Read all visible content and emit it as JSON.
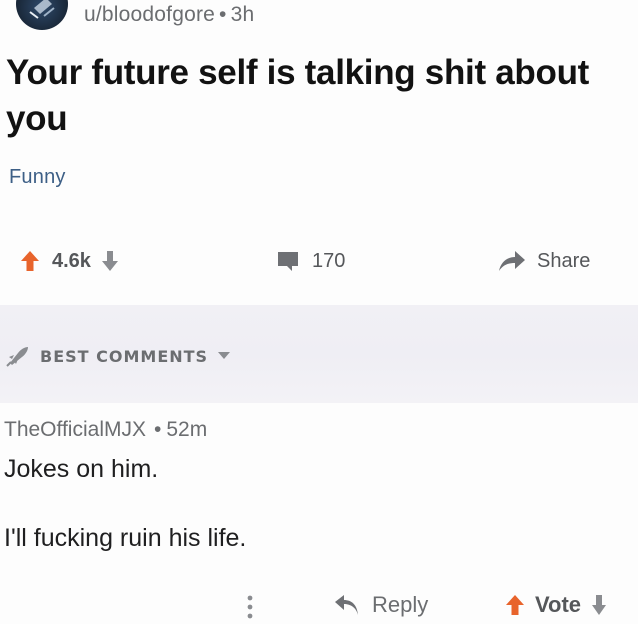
{
  "post": {
    "username": "u/bloodofgore",
    "separator": "•",
    "time": "3h",
    "title": "Your future self is talking shit about you",
    "flair": "Funny"
  },
  "actions": {
    "score": "4.6k",
    "comment_count": "170",
    "share_label": "Share"
  },
  "comments_sort": {
    "label": "BEST COMMENTS"
  },
  "comment": {
    "author": "TheOfficialMJX",
    "separator": "•",
    "time": "52m",
    "lines": [
      "Jokes on him.",
      "I'll fucking ruin his life."
    ],
    "reply_label": "Reply",
    "vote_label": "Vote"
  },
  "colors": {
    "upvote": "#e8642c",
    "muted": "#6b6d70",
    "flair": "#3d5f86",
    "band": "#f0eff4"
  }
}
